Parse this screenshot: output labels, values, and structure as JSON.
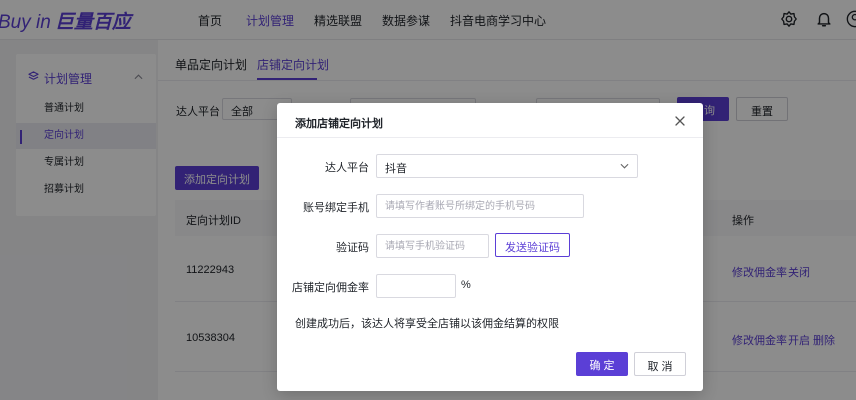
{
  "header": {
    "logo_text": "Buy in",
    "logo_cn": "巨量百应",
    "nav": [
      "首页",
      "计划管理",
      "精选联盟",
      "数据参谋",
      "抖音电商学习中心"
    ],
    "active_nav_index": 1,
    "icons": [
      "settings-icon",
      "bell-icon",
      "user-icon"
    ]
  },
  "sidebar": {
    "section_title": "计划管理",
    "items": [
      "普通计划",
      "定向计划",
      "专属计划",
      "招募计划"
    ],
    "active_index": 1
  },
  "main": {
    "tabs": [
      "单品定向计划",
      "店铺定向计划"
    ],
    "active_tab_index": 1,
    "filter": {
      "label": "达人平台",
      "value": "全部"
    },
    "query_label": "询",
    "reset_label": "重置",
    "add_button_label": "添加定向计划",
    "table": {
      "columns": [
        "定向计划ID",
        "操作"
      ],
      "rows": [
        {
          "id": "11222943",
          "actions": [
            "修改佣金率",
            "关闭"
          ]
        },
        {
          "id": "10538304",
          "actions": [
            "修改佣金率",
            "开启",
            "删除"
          ]
        }
      ]
    }
  },
  "modal": {
    "title": "添加店铺定向计划",
    "fields": {
      "platform": {
        "label": "达人平台",
        "value": "抖音"
      },
      "phone": {
        "label": "账号绑定手机",
        "placeholder": "请填写作者账号所绑定的手机号码"
      },
      "code": {
        "label": "验证码",
        "placeholder": "请填写手机验证码",
        "send_label": "发送验证码"
      },
      "rate": {
        "label": "店铺定向佣金率",
        "unit": "%"
      }
    },
    "note": "创建成功后，该达人将享受全店铺以该佣金结算的权限",
    "ok_label": "确 定",
    "cancel_label": "取 消"
  },
  "colors": {
    "accent": "#5b3fd6",
    "overlay": "rgba(0,0,0,0.45)"
  }
}
